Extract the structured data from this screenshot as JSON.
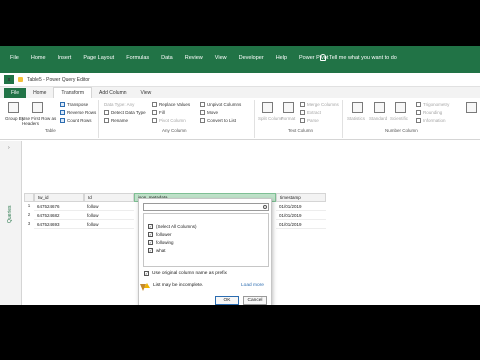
{
  "excel_tabs": [
    "File",
    "Home",
    "Insert",
    "Page Layout",
    "Formulas",
    "Data",
    "Review",
    "View",
    "Developer",
    "Help",
    "Power Pivot"
  ],
  "excel_search": "Tell me what you want to do",
  "pq_title": "Table5 - Power Query Editor",
  "pq_tabs": {
    "file": "File",
    "home": "Home",
    "transform": "Transform",
    "add_column": "Add Column",
    "view": "View"
  },
  "ribbon": {
    "group_by": "Group By",
    "use_first_row": "Use First Row as Headers",
    "transpose": "Transpose",
    "reverse_rows": "Reverse Rows",
    "count_rows": "Count Rows",
    "data_type": "Data Type: Any",
    "detect_type": "Detect Data Type",
    "rename": "Rename",
    "replace_values": "Replace Values",
    "fill": "Fill",
    "pivot_column": "Pivot Column",
    "unpivot_columns": "Unpivot Columns",
    "move": "Move",
    "convert_to_list": "Convert to List",
    "split_column": "Split Column",
    "format": "Format",
    "merge_columns": "Merge Columns",
    "extract": "Extract",
    "parse": "Parse",
    "statistics": "Statistics",
    "standard": "Standard",
    "scientific": "Scientific",
    "trigonometry": "Trigonometry",
    "rounding": "Rounding",
    "information": "Information",
    "group_table": "Table",
    "group_any_column": "Any Column",
    "group_text_column": "Text Column",
    "group_number_column": "Number Column"
  },
  "queries_label": "Queries",
  "columns": {
    "c1": "tw_id",
    "c2": "Id",
    "c3": "json_metadata",
    "c4": "timestamp"
  },
  "rows": [
    {
      "num": "1",
      "tw_id": "647524676",
      "id": "follow",
      "ts": "01/01/2019"
    },
    {
      "num": "2",
      "tw_id": "647524682",
      "id": "follow",
      "ts": "01/01/2019"
    },
    {
      "num": "3",
      "tw_id": "647524693",
      "id": "follow",
      "ts": "01/01/2019"
    }
  ],
  "popup": {
    "select_all": "(Select All Columns)",
    "items": [
      "follower",
      "following",
      "what"
    ],
    "prefix": "Use original column name as prefix",
    "warning": "List may be incomplete.",
    "load_more": "Load more",
    "ok": "OK",
    "cancel": "Cancel"
  }
}
